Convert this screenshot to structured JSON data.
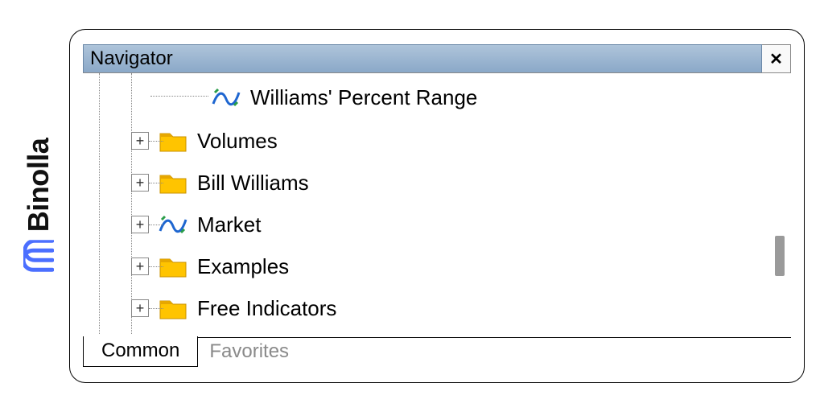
{
  "brand": {
    "name": "Binolla"
  },
  "panel": {
    "title": "Navigator"
  },
  "tree": {
    "leaf_indicator": "Williams' Percent Range",
    "folders": [
      {
        "label": "Volumes",
        "icon": "folder"
      },
      {
        "label": "Bill Williams",
        "icon": "folder"
      },
      {
        "label": "Market",
        "icon": "indicator"
      },
      {
        "label": "Examples",
        "icon": "folder"
      },
      {
        "label": "Free Indicators",
        "icon": "folder"
      }
    ]
  },
  "tabs": {
    "active": "Common",
    "inactive": "Favorites"
  }
}
